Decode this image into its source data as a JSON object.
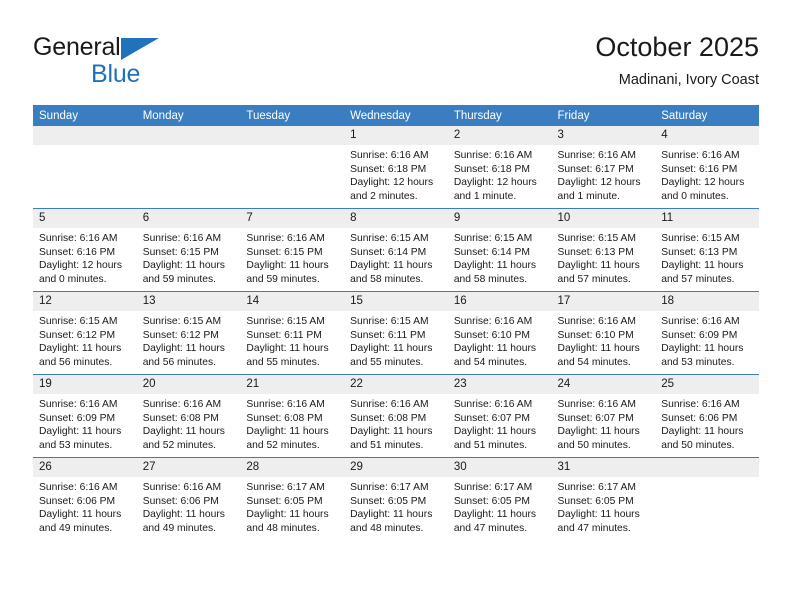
{
  "brand": {
    "name_part1": "General",
    "name_part2": "Blue",
    "logo_icon": "triangle-icon"
  },
  "header": {
    "title": "October 2025",
    "subtitle": "Madinani, Ivory Coast"
  },
  "colors": {
    "header_blue": "#3a7dc0",
    "brand_blue": "#1f72bb",
    "daynum_background": "#eeeeee",
    "text": "#1a1a1a"
  },
  "weekday_headers": [
    "Sunday",
    "Monday",
    "Tuesday",
    "Wednesday",
    "Thursday",
    "Friday",
    "Saturday"
  ],
  "weeks": [
    [
      {
        "day": "",
        "empty": true
      },
      {
        "day": "",
        "empty": true
      },
      {
        "day": "",
        "empty": true
      },
      {
        "day": "1",
        "sunrise": "Sunrise: 6:16 AM",
        "sunset": "Sunset: 6:18 PM",
        "daylight": "Daylight: 12 hours and 2 minutes."
      },
      {
        "day": "2",
        "sunrise": "Sunrise: 6:16 AM",
        "sunset": "Sunset: 6:18 PM",
        "daylight": "Daylight: 12 hours and 1 minute."
      },
      {
        "day": "3",
        "sunrise": "Sunrise: 6:16 AM",
        "sunset": "Sunset: 6:17 PM",
        "daylight": "Daylight: 12 hours and 1 minute."
      },
      {
        "day": "4",
        "sunrise": "Sunrise: 6:16 AM",
        "sunset": "Sunset: 6:16 PM",
        "daylight": "Daylight: 12 hours and 0 minutes."
      }
    ],
    [
      {
        "day": "5",
        "sunrise": "Sunrise: 6:16 AM",
        "sunset": "Sunset: 6:16 PM",
        "daylight": "Daylight: 12 hours and 0 minutes."
      },
      {
        "day": "6",
        "sunrise": "Sunrise: 6:16 AM",
        "sunset": "Sunset: 6:15 PM",
        "daylight": "Daylight: 11 hours and 59 minutes."
      },
      {
        "day": "7",
        "sunrise": "Sunrise: 6:16 AM",
        "sunset": "Sunset: 6:15 PM",
        "daylight": "Daylight: 11 hours and 59 minutes."
      },
      {
        "day": "8",
        "sunrise": "Sunrise: 6:15 AM",
        "sunset": "Sunset: 6:14 PM",
        "daylight": "Daylight: 11 hours and 58 minutes."
      },
      {
        "day": "9",
        "sunrise": "Sunrise: 6:15 AM",
        "sunset": "Sunset: 6:14 PM",
        "daylight": "Daylight: 11 hours and 58 minutes."
      },
      {
        "day": "10",
        "sunrise": "Sunrise: 6:15 AM",
        "sunset": "Sunset: 6:13 PM",
        "daylight": "Daylight: 11 hours and 57 minutes."
      },
      {
        "day": "11",
        "sunrise": "Sunrise: 6:15 AM",
        "sunset": "Sunset: 6:13 PM",
        "daylight": "Daylight: 11 hours and 57 minutes."
      }
    ],
    [
      {
        "day": "12",
        "sunrise": "Sunrise: 6:15 AM",
        "sunset": "Sunset: 6:12 PM",
        "daylight": "Daylight: 11 hours and 56 minutes."
      },
      {
        "day": "13",
        "sunrise": "Sunrise: 6:15 AM",
        "sunset": "Sunset: 6:12 PM",
        "daylight": "Daylight: 11 hours and 56 minutes."
      },
      {
        "day": "14",
        "sunrise": "Sunrise: 6:15 AM",
        "sunset": "Sunset: 6:11 PM",
        "daylight": "Daylight: 11 hours and 55 minutes."
      },
      {
        "day": "15",
        "sunrise": "Sunrise: 6:15 AM",
        "sunset": "Sunset: 6:11 PM",
        "daylight": "Daylight: 11 hours and 55 minutes."
      },
      {
        "day": "16",
        "sunrise": "Sunrise: 6:16 AM",
        "sunset": "Sunset: 6:10 PM",
        "daylight": "Daylight: 11 hours and 54 minutes."
      },
      {
        "day": "17",
        "sunrise": "Sunrise: 6:16 AM",
        "sunset": "Sunset: 6:10 PM",
        "daylight": "Daylight: 11 hours and 54 minutes."
      },
      {
        "day": "18",
        "sunrise": "Sunrise: 6:16 AM",
        "sunset": "Sunset: 6:09 PM",
        "daylight": "Daylight: 11 hours and 53 minutes."
      }
    ],
    [
      {
        "day": "19",
        "sunrise": "Sunrise: 6:16 AM",
        "sunset": "Sunset: 6:09 PM",
        "daylight": "Daylight: 11 hours and 53 minutes."
      },
      {
        "day": "20",
        "sunrise": "Sunrise: 6:16 AM",
        "sunset": "Sunset: 6:08 PM",
        "daylight": "Daylight: 11 hours and 52 minutes."
      },
      {
        "day": "21",
        "sunrise": "Sunrise: 6:16 AM",
        "sunset": "Sunset: 6:08 PM",
        "daylight": "Daylight: 11 hours and 52 minutes."
      },
      {
        "day": "22",
        "sunrise": "Sunrise: 6:16 AM",
        "sunset": "Sunset: 6:08 PM",
        "daylight": "Daylight: 11 hours and 51 minutes."
      },
      {
        "day": "23",
        "sunrise": "Sunrise: 6:16 AM",
        "sunset": "Sunset: 6:07 PM",
        "daylight": "Daylight: 11 hours and 51 minutes."
      },
      {
        "day": "24",
        "sunrise": "Sunrise: 6:16 AM",
        "sunset": "Sunset: 6:07 PM",
        "daylight": "Daylight: 11 hours and 50 minutes."
      },
      {
        "day": "25",
        "sunrise": "Sunrise: 6:16 AM",
        "sunset": "Sunset: 6:06 PM",
        "daylight": "Daylight: 11 hours and 50 minutes."
      }
    ],
    [
      {
        "day": "26",
        "sunrise": "Sunrise: 6:16 AM",
        "sunset": "Sunset: 6:06 PM",
        "daylight": "Daylight: 11 hours and 49 minutes."
      },
      {
        "day": "27",
        "sunrise": "Sunrise: 6:16 AM",
        "sunset": "Sunset: 6:06 PM",
        "daylight": "Daylight: 11 hours and 49 minutes."
      },
      {
        "day": "28",
        "sunrise": "Sunrise: 6:17 AM",
        "sunset": "Sunset: 6:05 PM",
        "daylight": "Daylight: 11 hours and 48 minutes."
      },
      {
        "day": "29",
        "sunrise": "Sunrise: 6:17 AM",
        "sunset": "Sunset: 6:05 PM",
        "daylight": "Daylight: 11 hours and 48 minutes."
      },
      {
        "day": "30",
        "sunrise": "Sunrise: 6:17 AM",
        "sunset": "Sunset: 6:05 PM",
        "daylight": "Daylight: 11 hours and 47 minutes."
      },
      {
        "day": "31",
        "sunrise": "Sunrise: 6:17 AM",
        "sunset": "Sunset: 6:05 PM",
        "daylight": "Daylight: 11 hours and 47 minutes."
      },
      {
        "day": "",
        "empty": true
      }
    ]
  ]
}
